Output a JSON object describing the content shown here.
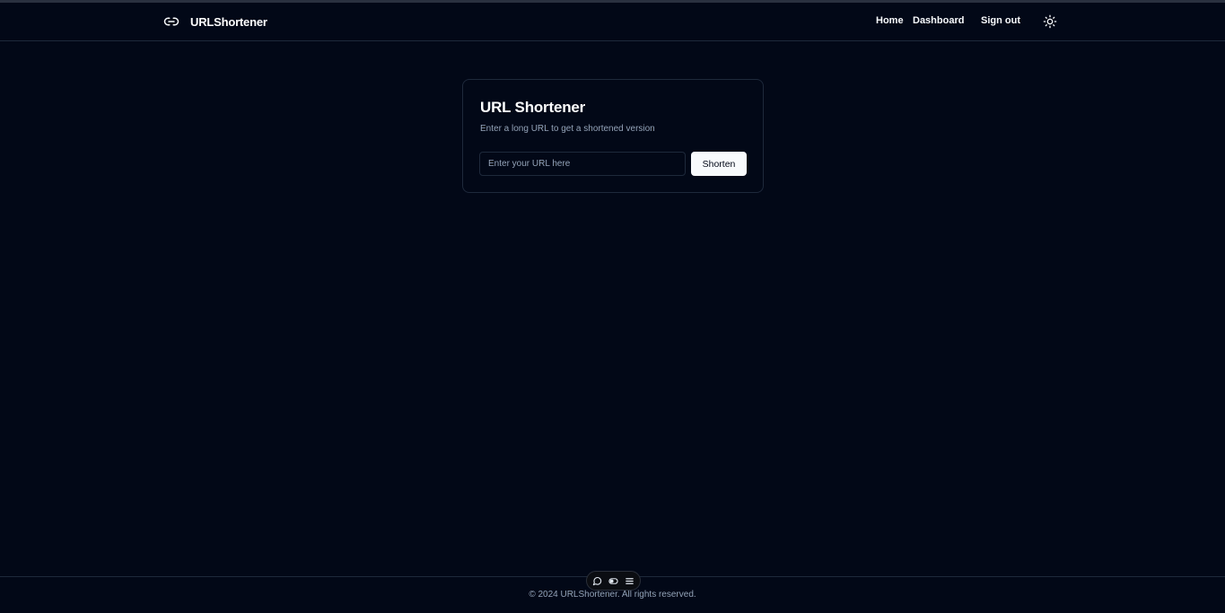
{
  "header": {
    "brand_name": "URLShortener",
    "brand_icon": "link-icon",
    "nav": {
      "home": "Home",
      "dashboard": "Dashboard",
      "sign_out": "Sign out"
    },
    "theme_icon": "sun-icon"
  },
  "card": {
    "title": "URL Shortener",
    "description": "Enter a long URL to get a shortened version",
    "input": {
      "placeholder": "Enter your URL here",
      "value": ""
    },
    "button_label": "Shorten"
  },
  "footer": {
    "copyright": "© 2024 URLShortener. All rights reserved."
  },
  "dev_toolbar": {
    "icons": [
      "chat-icon",
      "toggle-icon",
      "menu-icon"
    ]
  },
  "colors": {
    "background": "#020817",
    "border": "#1e293b",
    "muted_text": "#94a3b8",
    "primary": "#f8fafc"
  }
}
